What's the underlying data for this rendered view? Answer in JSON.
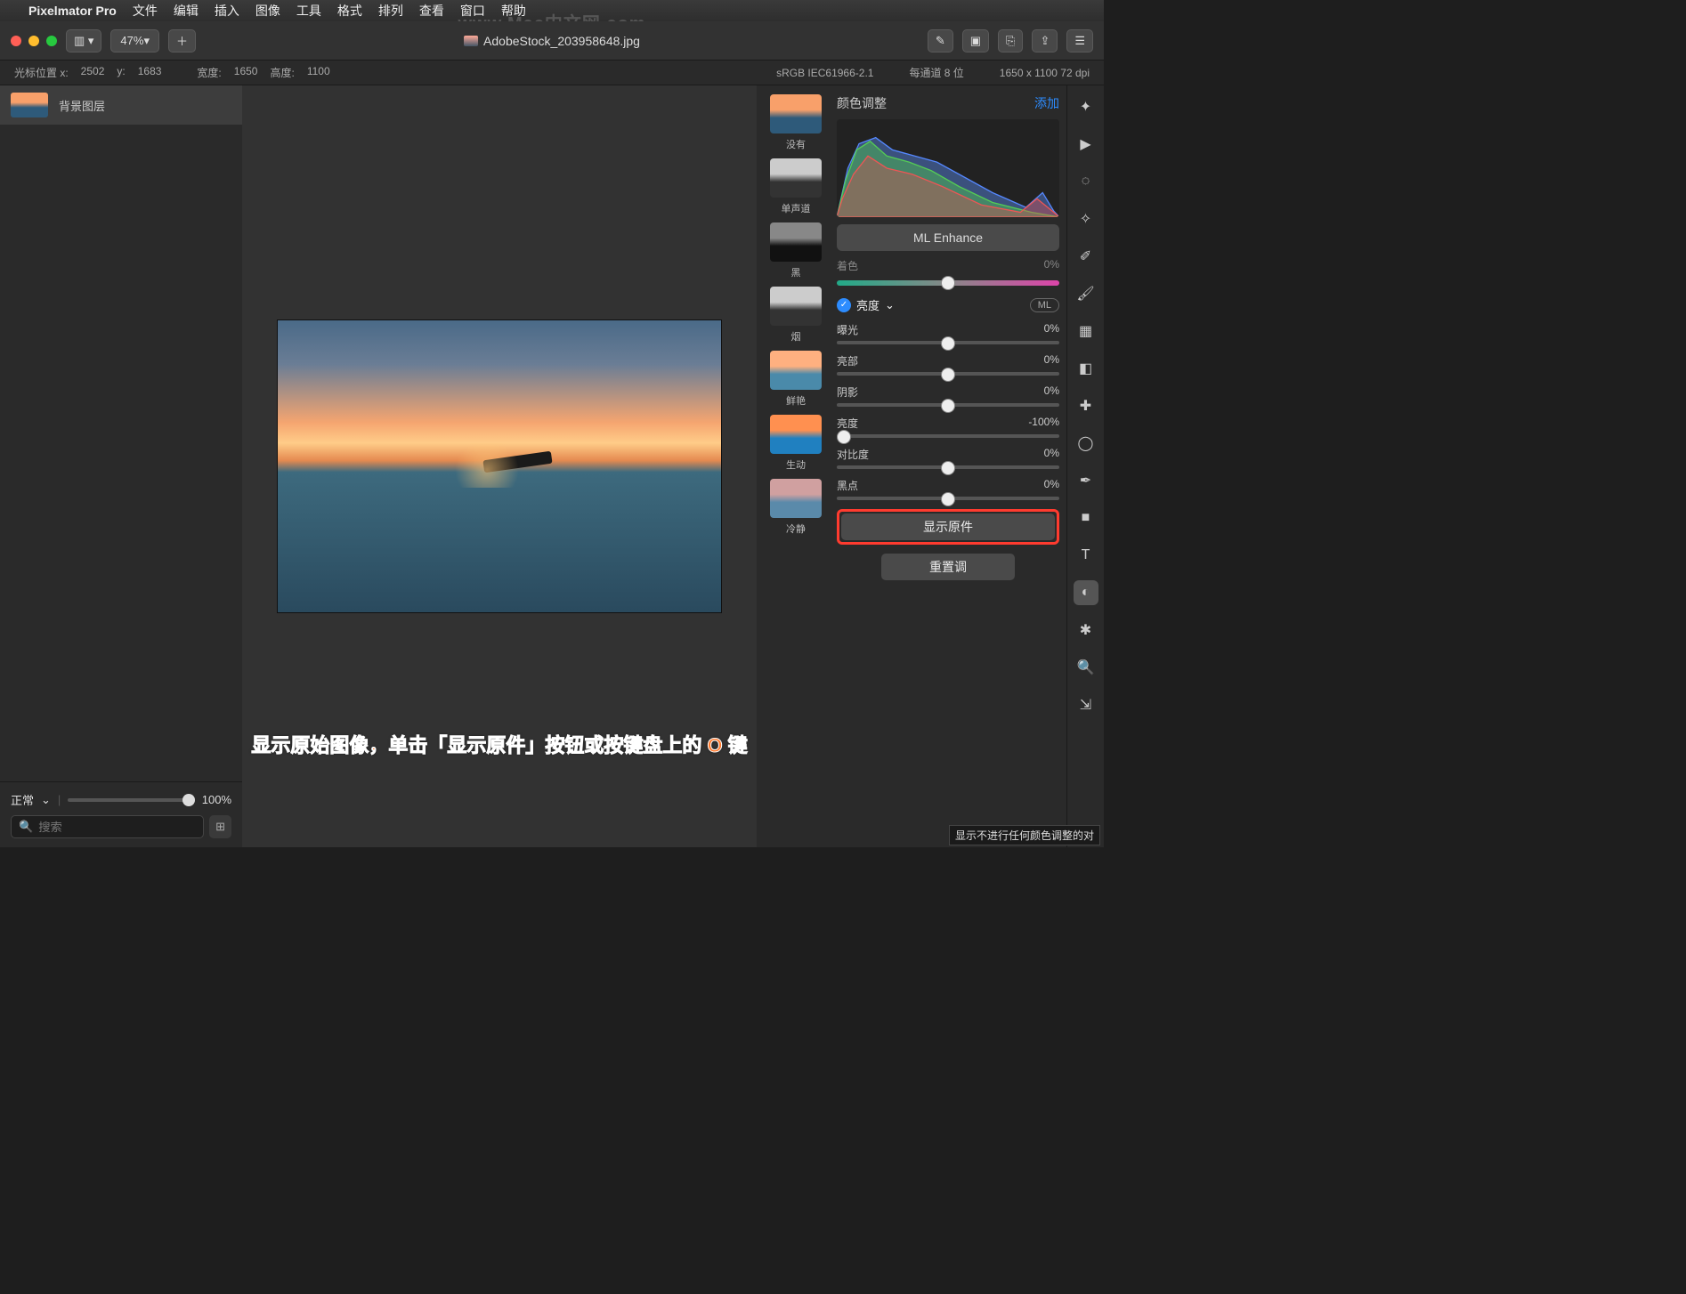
{
  "menubar": {
    "app_name": "Pixelmator Pro",
    "items": [
      "文件",
      "编辑",
      "插入",
      "图像",
      "工具",
      "格式",
      "排列",
      "查看",
      "窗口",
      "帮助"
    ]
  },
  "toolbar": {
    "zoom": "47%",
    "doc_title": "AdobeStock_203958648.jpg"
  },
  "statusbar": {
    "cursor_label": "光标位置 x:",
    "cursor_x": "2502",
    "cursor_y_label": "y:",
    "cursor_y": "1683",
    "width_label": "宽度:",
    "width": "1650",
    "height_label": "高度:",
    "height": "1100",
    "color_profile": "sRGB IEC61966-2.1",
    "depth": "每通道 8 位",
    "dims": "1650 x 1100 72 dpi"
  },
  "layers": {
    "item0": "背景图层",
    "blend_mode": "正常",
    "opacity": "100%",
    "search_placeholder": "搜索"
  },
  "adjust": {
    "title": "颜色调整",
    "add": "添加",
    "ml_enhance": "ML Enhance",
    "tint_label": "着色",
    "tint_value": "0%",
    "presets": {
      "none": "没有",
      "mono": "单声道",
      "black": "黑",
      "smoke": "烟",
      "vivid": "鲜艳",
      "live": "生动",
      "calm": "冷静"
    },
    "brightness_section": "亮度",
    "ml_pill": "ML",
    "params": {
      "exposure": {
        "label": "曝光",
        "value": "0%"
      },
      "highlights": {
        "label": "亮部",
        "value": "0%"
      },
      "shadows": {
        "label": "阴影",
        "value": "0%"
      },
      "brightness": {
        "label": "亮度",
        "value": "-100%"
      },
      "contrast": {
        "label": "对比度",
        "value": "0%"
      },
      "black": {
        "label": "黑点",
        "value": "0%"
      }
    },
    "show_original": "显示原件",
    "reset": "重置调",
    "tooltip": "显示不进行任何颜色调整的对"
  },
  "annotation": "显示原始图像，单击「显示原件」按钮或按键盘上的 O 键",
  "watermark": "www.Mac中文网.com"
}
